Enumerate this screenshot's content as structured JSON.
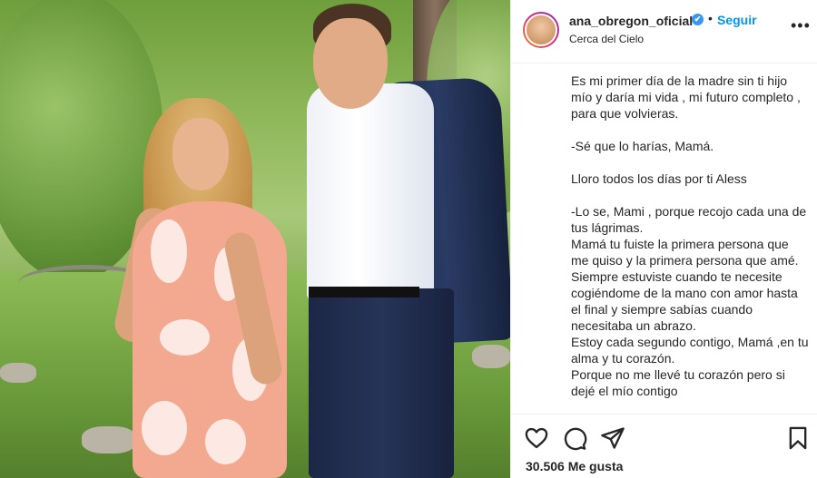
{
  "post": {
    "username": "ana_obregon_oficial",
    "verified_badge": "✔",
    "separator": "•",
    "follow_label": "Seguir",
    "location": "Cerca del Cielo",
    "more_icon": "•••",
    "caption_paragraphs": [
      "Es mi primer día de la madre sin ti hijo mío y daría mi vida , mi futuro completo , para que volvieras.",
      "-Sé que lo harías, Mamá.",
      "Lloro todos los días por ti Aless",
      "-Lo se, Mami , porque recojo cada una de tus lágrimas.\nMamá tu fuiste la primera persona que me quiso y la primera persona que amé.\nSiempre estuviste cuando te necesite cogiéndome de la mano con amor hasta el final y siempre sabías cuando necesitaba un abrazo.\nEstoy cada segundo contigo, Mamá ,en tu alma y tu corazón.\nPorque no me llevé tu corazón pero si dejé el mío contigo"
    ],
    "likes_text": "30.506 Me gusta",
    "icons": {
      "like": "heart-icon",
      "comment": "comment-icon",
      "share": "share-icon",
      "save": "bookmark-icon",
      "verified": "verified-icon"
    },
    "colors": {
      "follow_blue": "#0095f6",
      "verified_blue": "#3897f0",
      "text": "#262626"
    }
  }
}
